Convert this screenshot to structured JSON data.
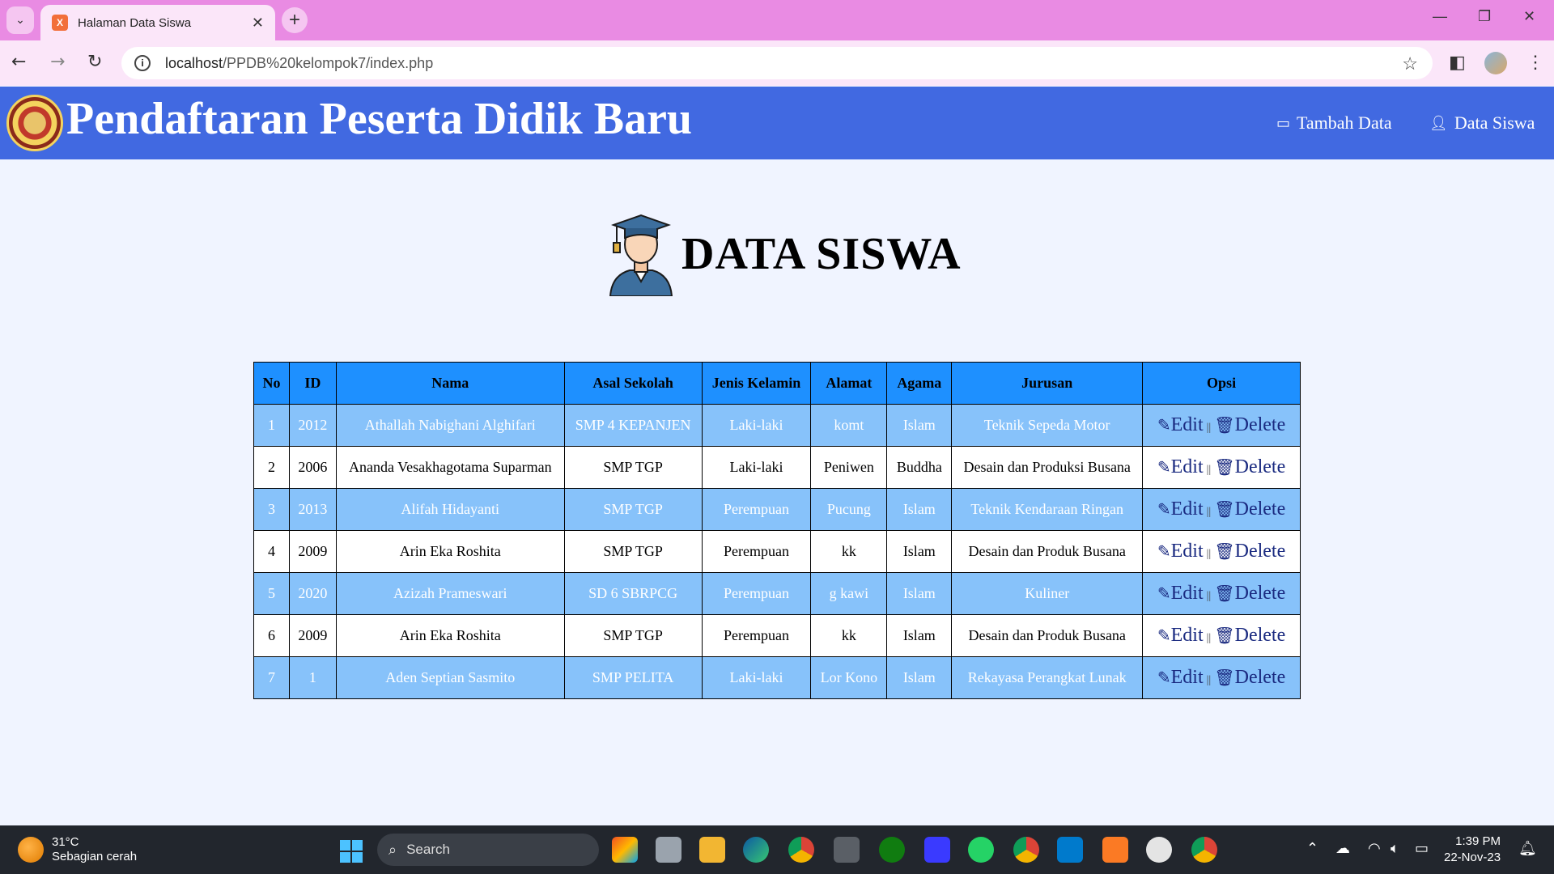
{
  "browser": {
    "tab_title": "Halaman Data Siswa",
    "url_host": "localhost",
    "url_path": "/PPDB%20kelompok7/index.php"
  },
  "header": {
    "site_title": "Pendaftaran Peserta Didik Baru",
    "nav": [
      {
        "label": "Tambah Data",
        "icon": "clipboard-icon"
      },
      {
        "label": "Data Siswa",
        "icon": "user-icon"
      }
    ]
  },
  "main": {
    "heading": "DATA SISWA",
    "table": {
      "columns": [
        "No",
        "ID",
        "Nama",
        "Asal Sekolah",
        "Jenis Kelamin",
        "Alamat",
        "Agama",
        "Jurusan",
        "Opsi"
      ],
      "edit_label": "Edit",
      "delete_label": "Delete",
      "separator": "||",
      "rows": [
        [
          "1",
          "2012",
          "Athallah Nabighani Alghifari",
          "SMP 4 KEPANJEN",
          "Laki-laki",
          "komt",
          "Islam",
          "Teknik Sepeda Motor"
        ],
        [
          "2",
          "2006",
          "Ananda Vesakhagotama Suparman",
          "SMP TGP",
          "Laki-laki",
          "Peniwen",
          "Buddha",
          "Desain dan Produksi Busana"
        ],
        [
          "3",
          "2013",
          "Alifah Hidayanti",
          "SMP TGP",
          "Perempuan",
          "Pucung",
          "Islam",
          "Teknik Kendaraan Ringan"
        ],
        [
          "4",
          "2009",
          "Arin Eka Roshita",
          "SMP TGP",
          "Perempuan",
          "kk",
          "Islam",
          "Desain dan Produk Busana"
        ],
        [
          "5",
          "2020",
          "Azizah Prameswari",
          "SD 6 SBRPCG",
          "Perempuan",
          "g kawi",
          "Islam",
          "Kuliner"
        ],
        [
          "6",
          "2009",
          "Arin Eka Roshita",
          "SMP TGP",
          "Perempuan",
          "kk",
          "Islam",
          "Desain dan Produk Busana"
        ],
        [
          "7",
          "1",
          "Aden Septian Sasmito",
          "SMP PELITA",
          "Laki-laki",
          "Lor Kono",
          "Islam",
          "Rekayasa Perangkat Lunak"
        ]
      ]
    }
  },
  "taskbar": {
    "weather_temp": "31°C",
    "weather_desc": "Sebagian cerah",
    "search_label": "Search",
    "time": "1:39 PM",
    "date": "22-Nov-23"
  },
  "colors": {
    "header_bg": "#4169e1",
    "table_header_bg": "#1e90ff",
    "odd_row_bg": "#87c2fa",
    "browser_tabbar": "#e98be3"
  }
}
